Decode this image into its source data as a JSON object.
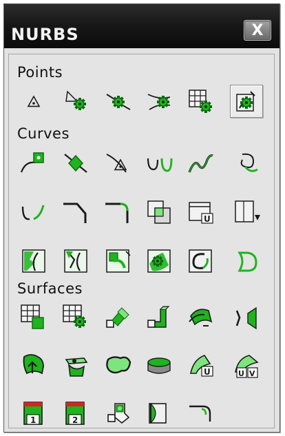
{
  "window": {
    "title": "NURBS",
    "close_label": "X"
  },
  "sections": [
    {
      "label": "Points",
      "tools": [
        {
          "name": "point-on-surface-tool",
          "icon": "triangle-point-icon"
        },
        {
          "name": "point-at-intersection-tool",
          "icon": "gear-point-icon"
        },
        {
          "name": "point-on-curve-tool",
          "icon": "point-on-curve-icon"
        },
        {
          "name": "point-between-curves-tool",
          "icon": "point-crossing-icon"
        },
        {
          "name": "point-on-grid-tool",
          "icon": "grid-point-icon"
        },
        {
          "name": "point-on-box-tool",
          "icon": "box-point-icon",
          "active": true
        }
      ]
    },
    {
      "label": "Curves",
      "tools": [
        {
          "name": "curve-end-box-tool",
          "icon": "curve-box-end-icon"
        },
        {
          "name": "curve-through-point-tool",
          "icon": "curve-diamond-icon"
        },
        {
          "name": "curve-from-triangle-tool",
          "icon": "curve-triangle-icon"
        },
        {
          "name": "hook-curve-pair-tool",
          "icon": "hook-pair-icon"
        },
        {
          "name": "freeform-curve-tool",
          "icon": "wave-curve-icon"
        },
        {
          "name": "hook-curve-tool",
          "icon": "hook-curve-icon"
        },
        {
          "name": "split-curve-tool",
          "icon": "split-curve-icon"
        },
        {
          "name": "bend-curve-tool",
          "icon": "bend-curve-icon"
        },
        {
          "name": "fillet-curve-tool",
          "icon": "fillet-curve-icon"
        },
        {
          "name": "offset-curve-tool",
          "icon": "overlap-squares-icon"
        },
        {
          "name": "curve-on-frame-tool",
          "icon": "frame-u-icon"
        },
        {
          "name": "project-curve-tool",
          "icon": "frame-arrow-icon"
        },
        {
          "name": "curve-on-surface-tool",
          "icon": "surface-curve-icon"
        },
        {
          "name": "trim-surface-curve-tool",
          "icon": "surface-trim-icon"
        },
        {
          "name": "boundary-curve-tool",
          "icon": "boundary-curve-icon"
        },
        {
          "name": "isoparm-curve-tool",
          "icon": "isoparm-icon"
        },
        {
          "name": "surface-edge-curve-tool",
          "icon": "edge-curve-icon"
        },
        {
          "name": "closed-curve-tool",
          "icon": "closed-curve-icon"
        }
      ]
    },
    {
      "label": "Surfaces",
      "tools": [
        {
          "name": "surface-from-grid-tool",
          "icon": "grid-surface-icon"
        },
        {
          "name": "surface-from-grid-points-tool",
          "icon": "grid-gear-icon"
        },
        {
          "name": "ruled-surface-tool",
          "icon": "ruled-surface-icon"
        },
        {
          "name": "extrude-surface-tool",
          "icon": "extrude-icon"
        },
        {
          "name": "sweep-surface-tool",
          "icon": "sweep-icon"
        },
        {
          "name": "loft-between-curves-tool",
          "icon": "loft-icon"
        },
        {
          "name": "patch-with-arrow-tool",
          "icon": "patch-arrow-icon"
        },
        {
          "name": "blend-surface-tool",
          "icon": "blend-icon"
        },
        {
          "name": "planar-patch-tool",
          "icon": "planar-patch-icon"
        },
        {
          "name": "cylinder-surface-tool",
          "icon": "cylinder-icon"
        },
        {
          "name": "surface-u-direction-tool",
          "icon": "surface-u-icon"
        },
        {
          "name": "surface-uv-direction-tool",
          "icon": "surface-uv-icon"
        },
        {
          "name": "trim-region-1-tool",
          "icon": "region-1-icon",
          "badge": "1"
        },
        {
          "name": "trim-region-2-tool",
          "icon": "region-2-icon",
          "badge": "2"
        },
        {
          "name": "boolean-surface-tool",
          "icon": "boolean-icon"
        },
        {
          "name": "revolve-surface-tool",
          "icon": "revolve-icon"
        },
        {
          "name": "fillet-surface-tool",
          "icon": "fillet-surface-icon"
        }
      ]
    }
  ],
  "colors": {
    "accent_green": "#1fb31f",
    "light_green": "#7ee57e",
    "dark_green": "#0a6b0a",
    "icon_dark": "#1a1a1a",
    "marker_red": "#d0281a",
    "panel_bg": "#e2e2e2"
  }
}
